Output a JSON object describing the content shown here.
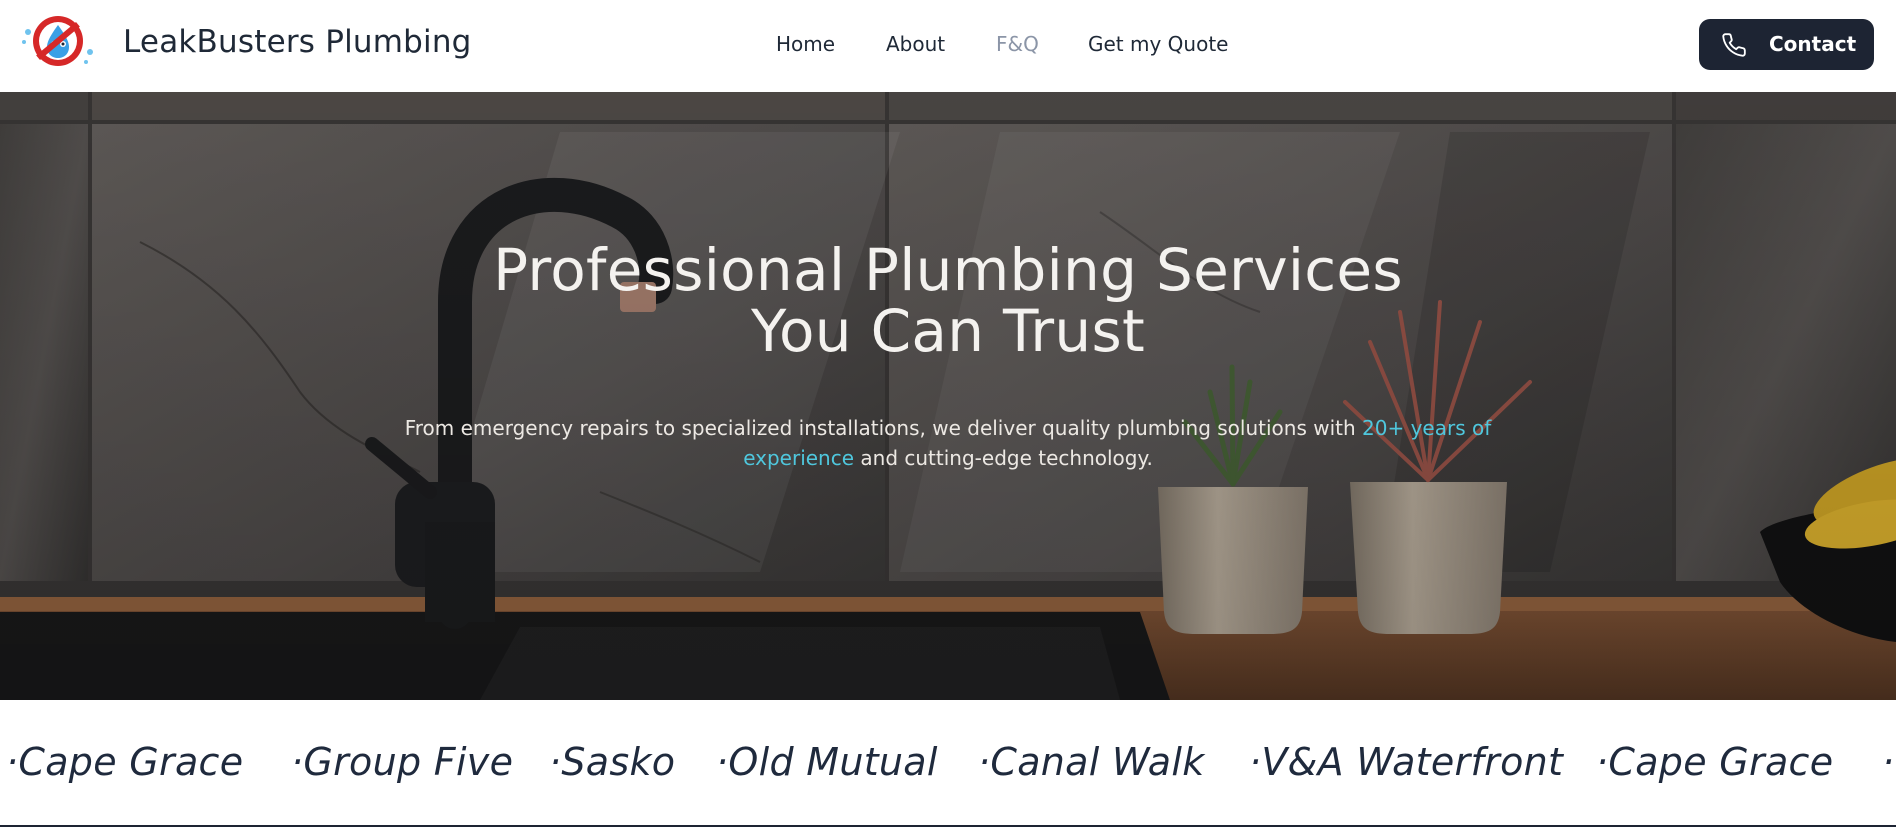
{
  "header": {
    "brand": "LeakBusters Plumbing",
    "logo_icon": "ghostbusters-droplet-logo-icon",
    "nav": [
      {
        "label": "Home",
        "active": false
      },
      {
        "label": "About",
        "active": false
      },
      {
        "label": "F&Q",
        "active": true
      },
      {
        "label": "Get my Quote",
        "active": false
      }
    ],
    "contact": {
      "label": "Contact",
      "icon": "phone-icon"
    }
  },
  "hero": {
    "title_line1": "Professional Plumbing Services",
    "title_line2": "You Can Trust",
    "sub_before": "From emergency repairs to specialized installations, we deliver quality plumbing solutions with ",
    "sub_accent": "20+ years of experience",
    "sub_after": " and cutting-edge technology.",
    "accent_color": "#4fc7dd"
  },
  "clients": [
    "·Cape Grace",
    "·Group Five",
    "·Sasko",
    "·Old Mutual",
    "·Canal Walk",
    "·V&A Waterfront",
    "·Cape Grace",
    "·"
  ],
  "colors": {
    "primary_dark": "#1d2433",
    "muted_nav": "#8b95a7",
    "accent": "#4fc7dd"
  }
}
